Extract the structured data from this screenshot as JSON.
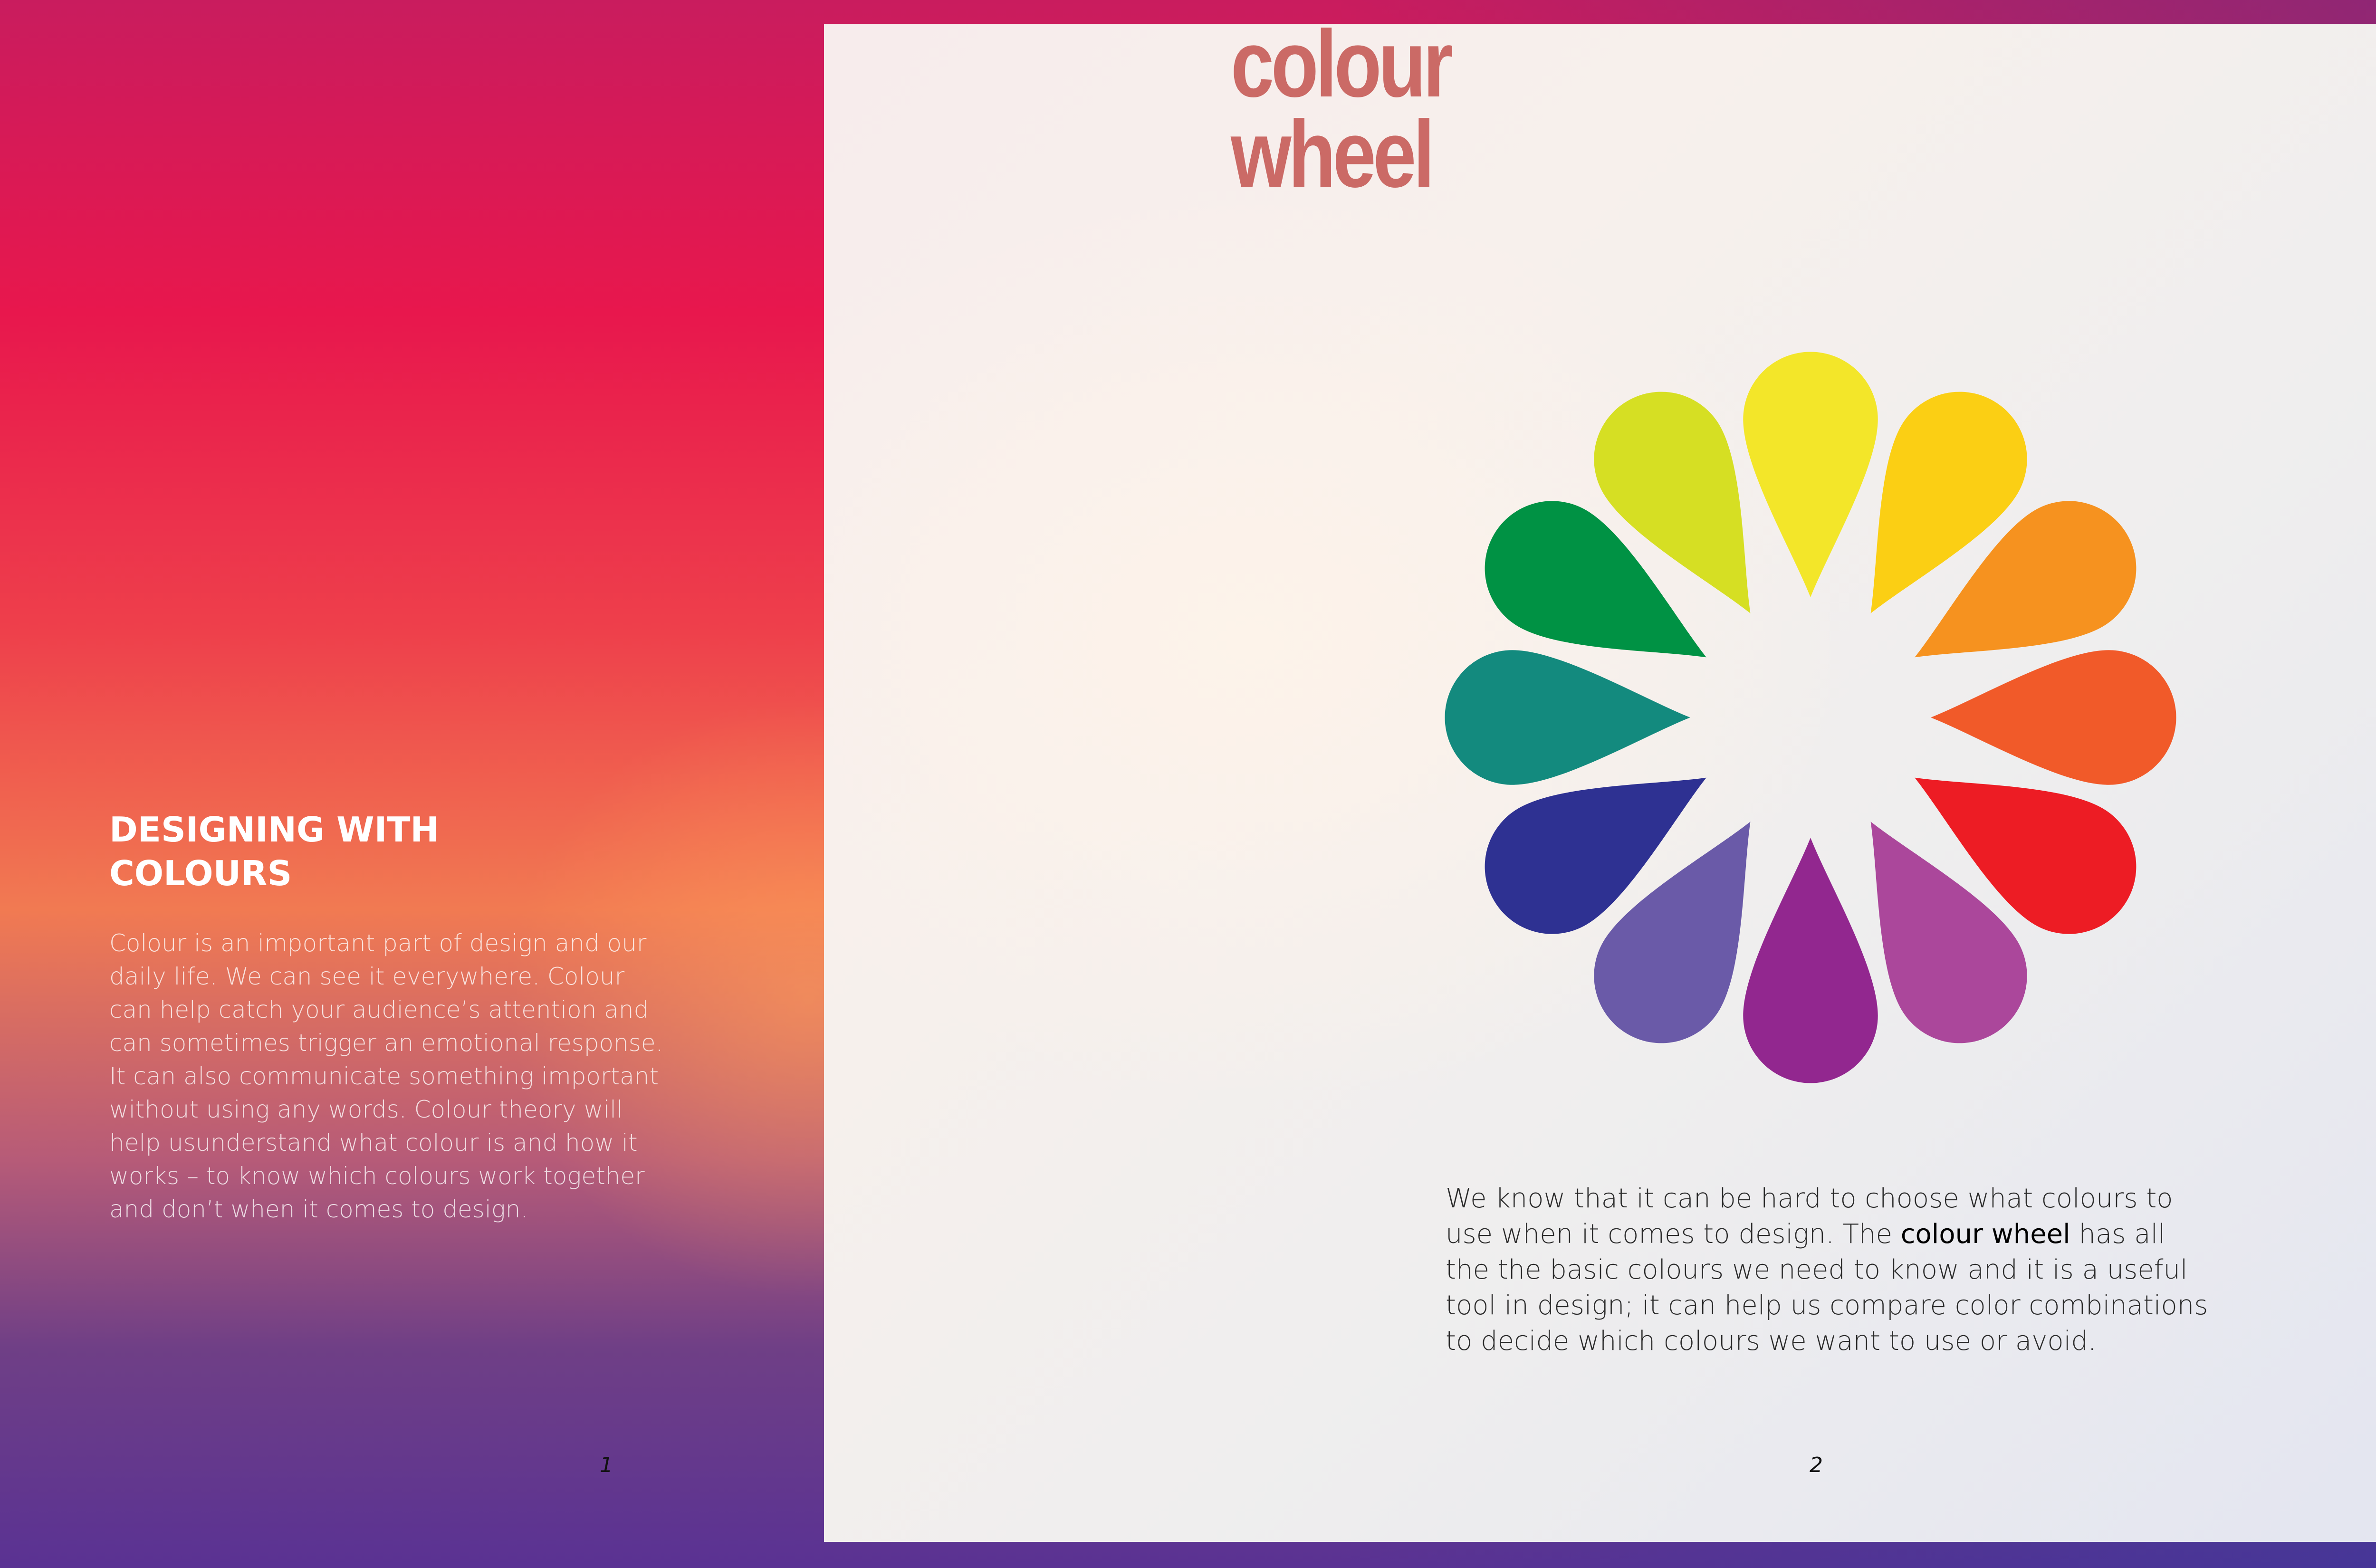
{
  "left_page": {
    "heading_line1": "DESIGNING WITH",
    "heading_line2": "COLOURS",
    "body": "Colour is an important part of design and our daily life. We can see it everywhere. Colour can help catch your audience’s attention and can sometimes trigger an emotional response. It can also communicate something important without using any words. Colour theory will help usunderstand what colour is and how it works – to know which colours work together and don’t when it comes to design.",
    "page_number": "1"
  },
  "right_page": {
    "title_line1": "colour",
    "title_line2": "wheel",
    "body_part1": "We know that it can be hard to choose what colours to use when it comes to design.  The ",
    "body_highlight": "colour wheel",
    "body_part2": " has all the the basic colours we need to know and it is a useful tool in design; it can help us compare color combinations to decide which colours we want to use or avoid.",
    "page_number": "2"
  },
  "colour_wheel": {
    "petal_colors": [
      "#f3e629",
      "#fbcf14",
      "#f6921f",
      "#f15a29",
      "#ed1c24",
      "#ab479b",
      "#92278f",
      "#6a5aa8",
      "#2e3192",
      "#138a7e",
      "#009244",
      "#d6df23"
    ]
  },
  "colors": {
    "title": "#cb6a66",
    "left_heading": "#ffffff"
  }
}
